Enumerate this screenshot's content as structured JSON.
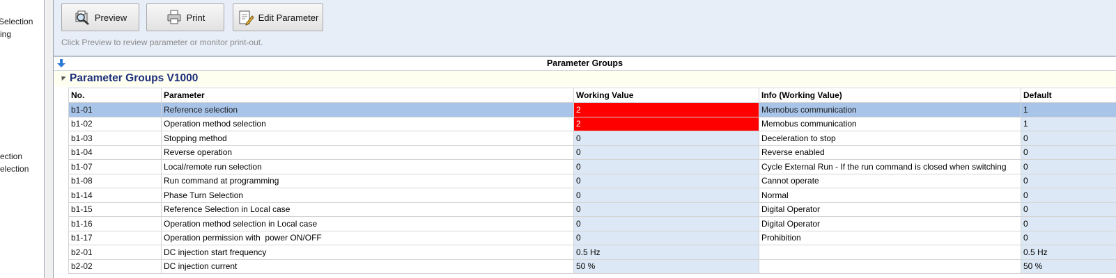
{
  "left_panel": {
    "fragments": [
      "Selection",
      "ing",
      "ection",
      "election"
    ]
  },
  "toolbar": {
    "preview_label": "Preview",
    "print_label": "Print",
    "edit_label": "Edit Parameter",
    "hint": "Click Preview to review parameter or monitor print-out."
  },
  "section": {
    "title": "Parameter Groups"
  },
  "group": {
    "title": "Parameter Groups V1000"
  },
  "table": {
    "headers": [
      "No.",
      "Parameter",
      "Working Value",
      "Info (Working Value)",
      "Default"
    ],
    "rows": [
      {
        "no": "b1-01",
        "param": "Reference selection",
        "wv": "2",
        "info": "Memobus communication",
        "def": "1"
      },
      {
        "no": "b1-02",
        "param": "Operation method selection",
        "wv": "2",
        "info": "Memobus communication",
        "def": "1"
      },
      {
        "no": "b1-03",
        "param": "Stopping method",
        "wv": "0",
        "info": "Deceleration to stop",
        "def": "0"
      },
      {
        "no": "b1-04",
        "param": "Reverse operation",
        "wv": "0",
        "info": "Reverse enabled",
        "def": "0"
      },
      {
        "no": "b1-07",
        "param": "Local/remote run selection",
        "wv": "0",
        "info": "Cycle External Run - If the run command is closed when switching",
        "def": "0"
      },
      {
        "no": "b1-08",
        "param": "Run command at programming",
        "wv": "0",
        "info": "Cannot operate",
        "def": "0"
      },
      {
        "no": "b1-14",
        "param": "Phase Turn Selection",
        "wv": "0",
        "info": "Normal",
        "def": "0"
      },
      {
        "no": "b1-15",
        "param": "Reference Selection in Local case",
        "wv": "0",
        "info": "Digital Operator",
        "def": "0"
      },
      {
        "no": "b1-16",
        "param": "Operation method selection in Local case",
        "wv": "0",
        "info": "Digital Operator",
        "def": "0"
      },
      {
        "no": "b1-17",
        "param": "Operation permission with  power ON/OFF",
        "wv": "0",
        "info": "Prohibition",
        "def": "0"
      },
      {
        "no": "b2-01",
        "param": "DC injection start frequency",
        "wv": "0.5 Hz",
        "info": "",
        "def": "0.5 Hz"
      },
      {
        "no": "b2-02",
        "param": "DC injection current",
        "wv": "50 %",
        "info": "",
        "def": "50 %"
      }
    ]
  },
  "colors": {
    "changed": "#ff0000",
    "selected": "#a8c4e8",
    "value_column": "#dce8f5",
    "group_title": "#1c2f7a"
  }
}
